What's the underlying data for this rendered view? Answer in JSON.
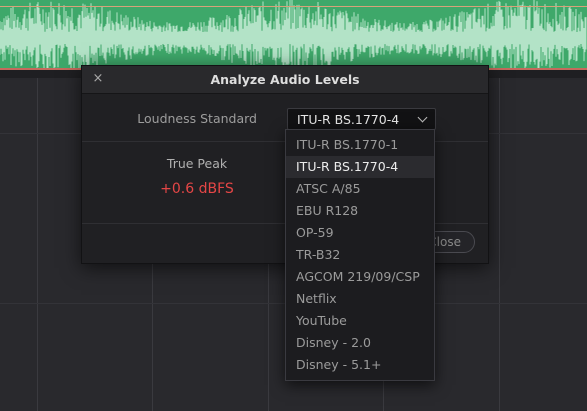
{
  "dialog": {
    "title": "Analyze Audio Levels",
    "close_symbol": "×",
    "loudness_standard_label": "Loudness Standard",
    "selected_standard": "ITU-R BS.1770-4",
    "true_peak_label": "True Peak",
    "true_peak_value": "+0.6 dBFS",
    "close_button_label": "Close"
  },
  "dropdown": {
    "options": [
      "ITU-R BS.1770-1",
      "ITU-R BS.1770-4",
      "ATSC A/85",
      "EBU R128",
      "OP-59",
      "TR-B32",
      "AGCOM 219/09/CSP",
      "Netflix",
      "YouTube",
      "Disney - 2.0",
      "Disney - 5.1+"
    ],
    "selected_index": 1
  },
  "colors": {
    "track": "#3ea86a",
    "waveform": "#c8eed8",
    "peak_warning": "#e54646",
    "background": "#29292d"
  }
}
